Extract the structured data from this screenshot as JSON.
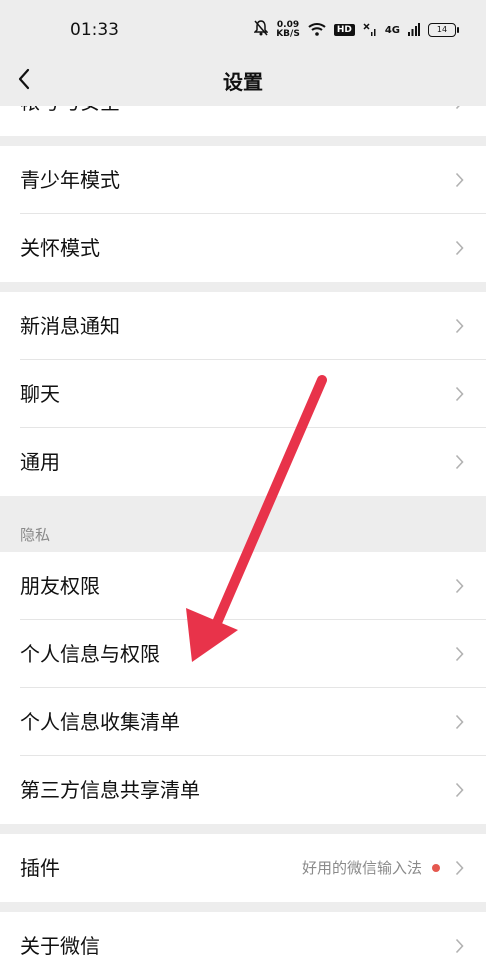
{
  "status": {
    "time": "01:33",
    "speed_value": "0.09",
    "speed_unit": "KB/S",
    "hd": "HD",
    "network": "4G",
    "battery": "14"
  },
  "nav": {
    "title": "设置"
  },
  "items": {
    "account": "帐号与安全",
    "youth": "青少年模式",
    "care": "关怀模式",
    "notify": "新消息通知",
    "chat": "聊天",
    "general": "通用",
    "privacy_header": "隐私",
    "friends_perm": "朋友权限",
    "personal_perm": "个人信息与权限",
    "personal_collect": "个人信息收集清单",
    "third_party": "第三方信息共享清单",
    "plugins": "插件",
    "plugins_hint": "好用的微信输入法",
    "about": "关于微信"
  },
  "colors": {
    "arrow": "#e8334a",
    "badge": "#e5584f"
  }
}
